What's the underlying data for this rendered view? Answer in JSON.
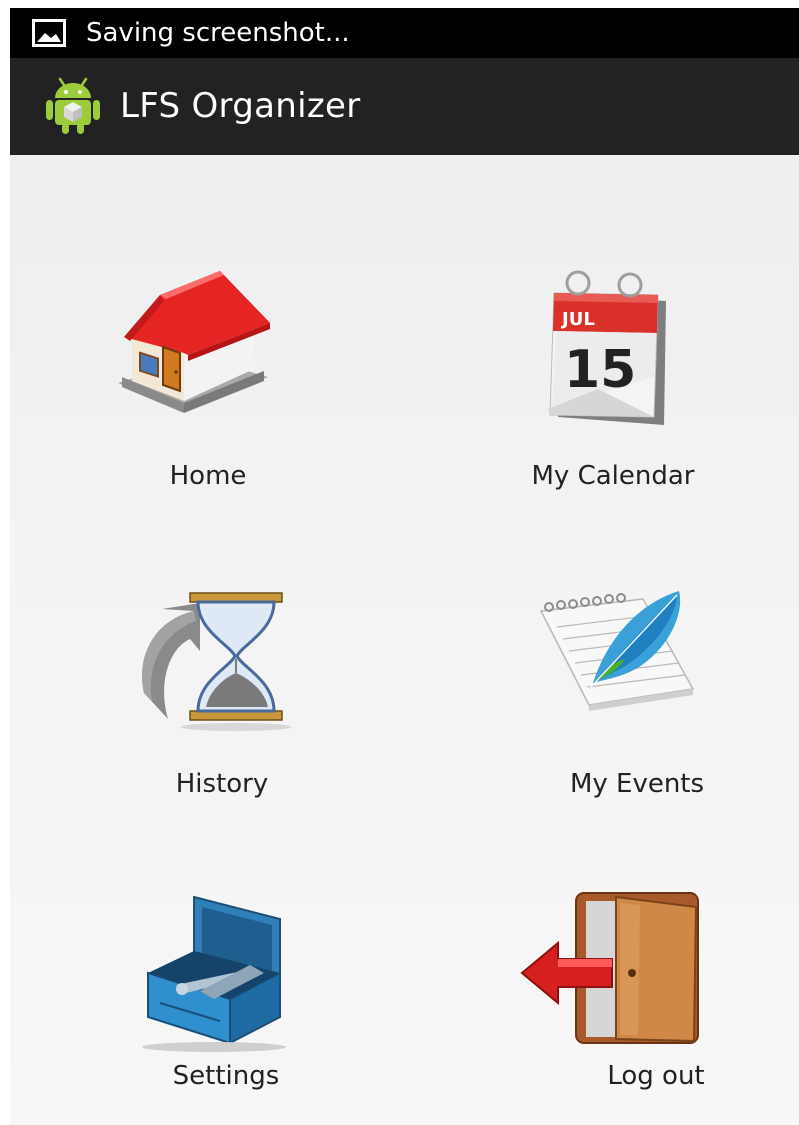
{
  "status_bar": {
    "notification_icon": "image-icon",
    "text": "Saving screenshot..."
  },
  "action_bar": {
    "app_icon": "android-icon",
    "title": "LFS Organizer"
  },
  "menu": [
    {
      "label": "Home",
      "icon": "house-icon"
    },
    {
      "label": "My Calendar",
      "icon": "calendar-icon"
    },
    {
      "label": "History",
      "icon": "hourglass-icon"
    },
    {
      "label": "My Events",
      "icon": "notepad-quill-icon"
    },
    {
      "label": "Settings",
      "icon": "toolbox-icon"
    },
    {
      "label": "Log out",
      "icon": "exit-door-icon"
    }
  ],
  "calendar_icon": {
    "month": "JUL",
    "day": "15"
  },
  "colors": {
    "status_bar": "#000000",
    "action_bar": "#222222",
    "background": "#f1f1f1",
    "label_text": "#222222"
  }
}
